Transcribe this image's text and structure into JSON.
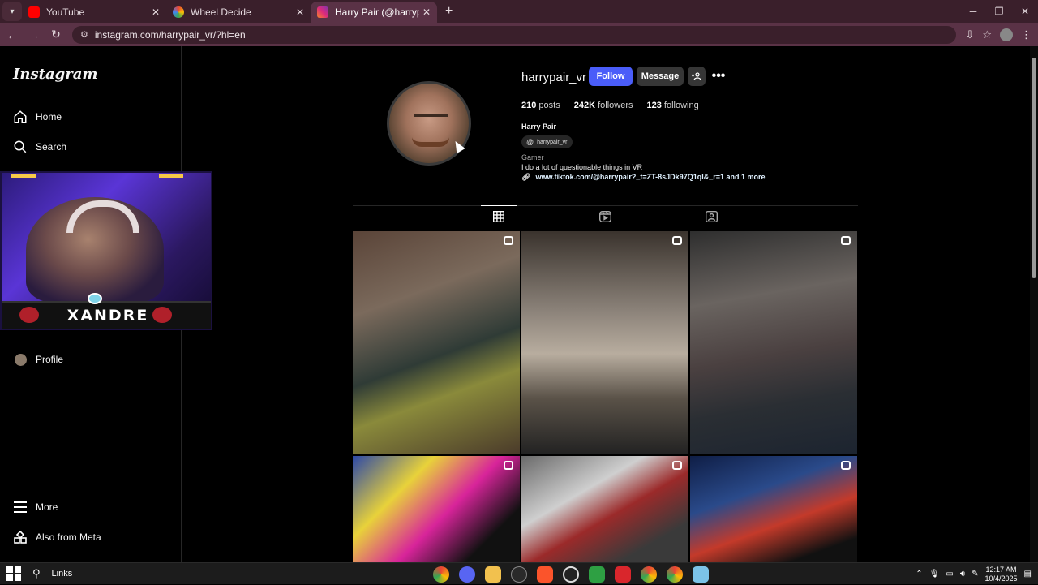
{
  "browser": {
    "tabs": [
      {
        "title": "YouTube",
        "color": "#ff0000",
        "active": false
      },
      {
        "title": "Wheel Decide",
        "color": "#f5b400",
        "active": false
      },
      {
        "title": "Harry Pair (@harrypair_vr) • Insta",
        "color": "#e1306c",
        "active": true
      }
    ],
    "url": "instagram.com/harrypair_vr/?hl=en"
  },
  "sidebar": {
    "logo": "Instagram",
    "items": [
      {
        "label": "Home",
        "icon": "home-icon"
      },
      {
        "label": "Search",
        "icon": "search-icon"
      },
      {
        "label": "Profile",
        "icon": "avatar"
      },
      {
        "label": "More",
        "icon": "hamburger-icon"
      },
      {
        "label": "Also from Meta",
        "icon": "meta-icon"
      }
    ]
  },
  "webcam": {
    "streamer_name": "XANDRE"
  },
  "profile": {
    "username": "harrypair_vr",
    "follow_label": "Follow",
    "message_label": "Message",
    "posts_count": "210",
    "posts_label": "posts",
    "followers_count": "242K",
    "followers_label": "followers",
    "following_count": "123",
    "following_label": "following",
    "full_name": "Harry Pair",
    "threads_handle": "harrypair_vr",
    "category": "Gamer",
    "bio": "I do a lot of questionable things in VR",
    "link": "www.tiktok.com/@harrypair?_t=ZT-8sJDk97Q1ql&_r=1 and 1 more"
  },
  "taskbar": {
    "search_label": "Links",
    "time": "12:17 AM",
    "date": "10/4/2025"
  }
}
